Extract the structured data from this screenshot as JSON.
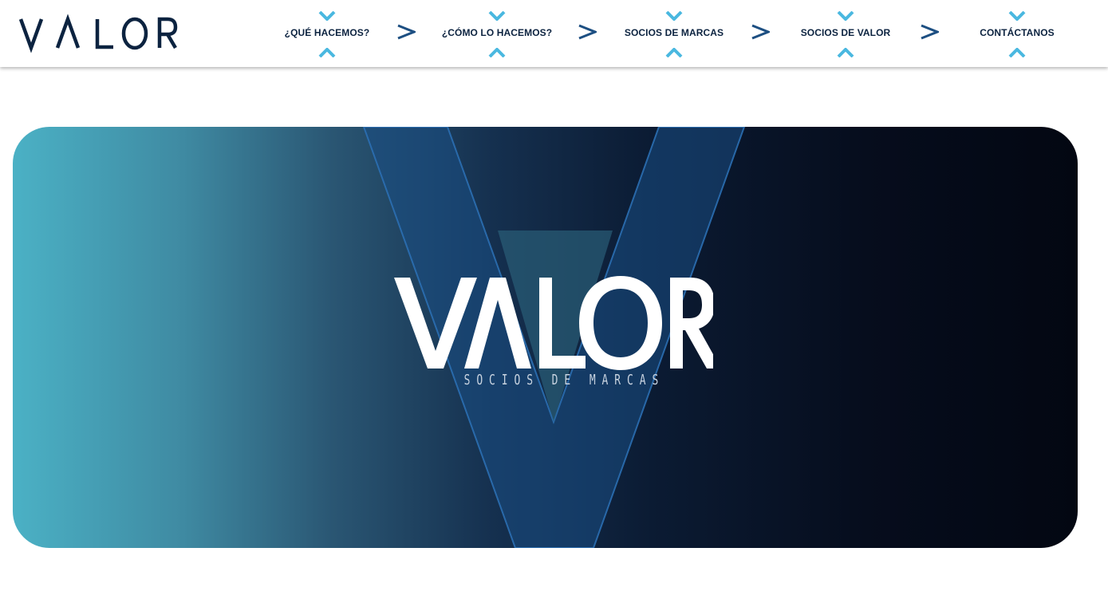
{
  "brand": {
    "name": "VALOR",
    "tagline": "SOCIOS DE MARCAS"
  },
  "nav": {
    "items": [
      {
        "label": "¿QUÉ HACEMOS?"
      },
      {
        "label": "¿CÓMO LO HACEMOS?"
      },
      {
        "label": "SOCIOS DE MARCAS"
      },
      {
        "label": "SOCIOS DE VALOR"
      },
      {
        "label": "CONTÁCTANOS"
      }
    ],
    "separator": ">"
  },
  "hero": {
    "title": "VALOR",
    "tagline": "SOCIOS DE MARCAS"
  },
  "colors": {
    "navy": "#0c2340",
    "accent": "#4ab8e0",
    "hero_left": "#4bb1c5",
    "hero_right": "#030712"
  },
  "icons": {
    "nav_top": "chevron-down-icon",
    "nav_bottom": "chevron-up-icon",
    "separator": "chevron-right-icon"
  }
}
